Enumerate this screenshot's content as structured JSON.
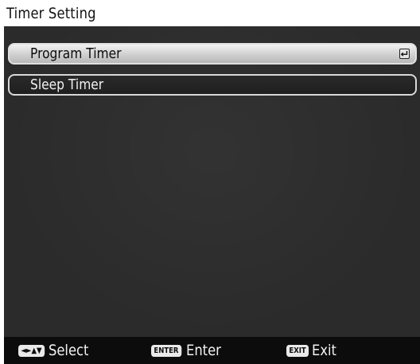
{
  "screen": {
    "title": "Timer Setting"
  },
  "menu": {
    "items": [
      {
        "label": "Program Timer",
        "selected": true,
        "trailing_icon": "enter-return-icon"
      },
      {
        "label": "Sleep Timer",
        "selected": false
      }
    ]
  },
  "footer": {
    "hints": [
      {
        "key": "◄►▲▼",
        "label": "Select"
      },
      {
        "key": "ENTER",
        "label": "Enter"
      },
      {
        "key": "EXIT",
        "label": "Exit"
      }
    ]
  },
  "colors": {
    "panel_background": "#2b2b2b",
    "selected_item_background": "#d4d4d4",
    "footer_background": "#0c0c0c",
    "text_light": "#f1f1f1",
    "text_dark": "#0c0c0c"
  }
}
